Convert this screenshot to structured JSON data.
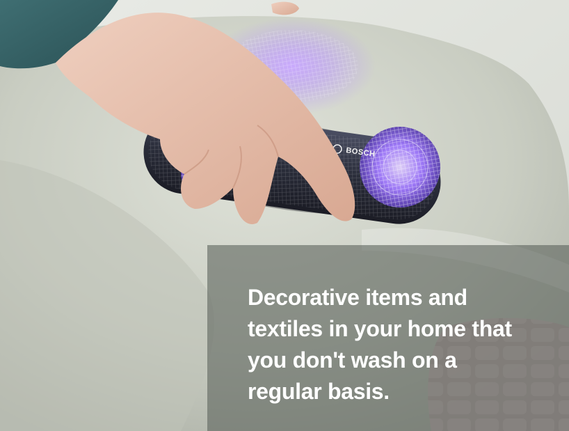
{
  "image": {
    "brand_label": "BOSCH",
    "caption_lines": [
      "Decorative items and",
      "textiles in your home that",
      "you don't wash on a",
      "regular basis."
    ],
    "colors": {
      "caption_overlay": "#585e58",
      "caption_text": "#ffffff",
      "device_glow": "#a67cff",
      "pillow": "#cfd3c8",
      "device_body": "#2a2d3a"
    }
  }
}
